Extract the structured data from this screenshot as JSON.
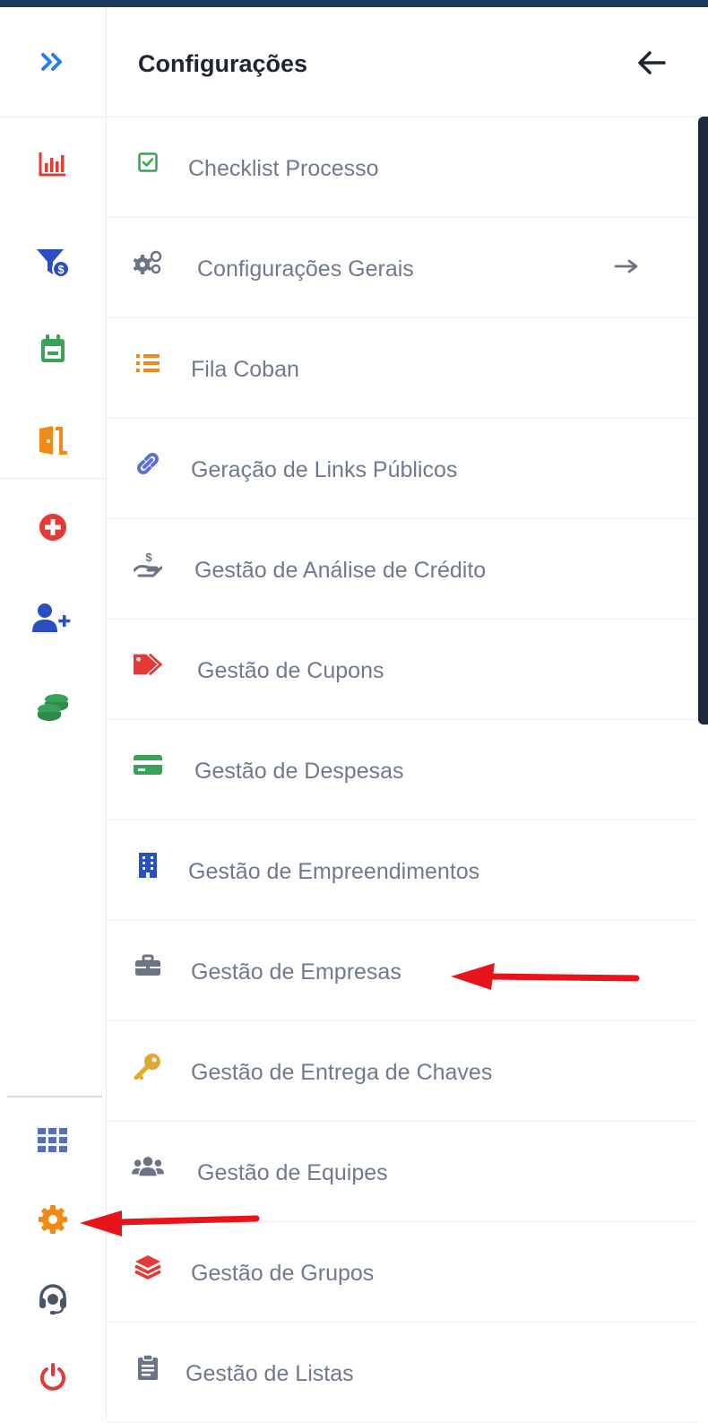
{
  "header": {
    "title": "Configurações"
  },
  "rail": {
    "items": [
      {
        "id": "expand",
        "icon": "double-chevron-right-icon",
        "color": "#2b7de9"
      },
      {
        "id": "reports",
        "icon": "bar-chart-icon",
        "color": "#e53935"
      },
      {
        "id": "funnel",
        "icon": "funnel-dollar-icon",
        "color": "#2b4fbf"
      },
      {
        "id": "calendar",
        "icon": "calendar-icon",
        "color": "#3aa15a"
      },
      {
        "id": "exit",
        "icon": "door-exit-icon",
        "color": "#f08a14"
      },
      {
        "id": "add",
        "icon": "plus-circle-icon",
        "color": "#e53935"
      },
      {
        "id": "add-user",
        "icon": "user-plus-icon",
        "color": "#2b4fbf"
      },
      {
        "id": "coins",
        "icon": "coins-icon",
        "color": "#3aa15a"
      },
      {
        "id": "apps",
        "icon": "grid-icon",
        "color": "#5b6fb0"
      },
      {
        "id": "settings",
        "icon": "gear-icon",
        "color": "#f08a14"
      },
      {
        "id": "support",
        "icon": "headset-icon",
        "color": "#4a5568"
      },
      {
        "id": "power",
        "icon": "power-icon",
        "color": "#e53935"
      }
    ]
  },
  "menu": {
    "items": [
      {
        "label": "Checklist Processo",
        "icon": "checkbox-icon",
        "color": "#3aa15a"
      },
      {
        "label": "Configurações Gerais",
        "icon": "cogs-icon",
        "color": "#6b7385",
        "arrow": "arrow-right-icon"
      },
      {
        "label": "Fila Coban",
        "icon": "list-icon",
        "color": "#f08a14"
      },
      {
        "label": "Geração de Links Públicos",
        "icon": "link-icon",
        "color": "#5b6fe0"
      },
      {
        "label": "Gestão de Análise de Crédito",
        "icon": "hand-dollar-icon",
        "color": "#6b7385"
      },
      {
        "label": "Gestão de Cupons",
        "icon": "tags-icon",
        "color": "#e53935"
      },
      {
        "label": "Gestão de Despesas",
        "icon": "credit-card-icon",
        "color": "#3aa15a"
      },
      {
        "label": "Gestão de Empreendimentos",
        "icon": "building-icon",
        "color": "#2b4fbf"
      },
      {
        "label": "Gestão de Empresas",
        "icon": "briefcase-icon",
        "color": "#6b7385"
      },
      {
        "label": "Gestão de Entrega de Chaves",
        "icon": "key-icon",
        "color": "#e0a82e"
      },
      {
        "label": "Gestão de Equipes",
        "icon": "users-icon",
        "color": "#6b7385"
      },
      {
        "label": "Gestão de Grupos",
        "icon": "layers-icon",
        "color": "#e53935"
      },
      {
        "label": "Gestão de Listas",
        "icon": "clipboard-icon",
        "color": "#6b7385"
      }
    ]
  },
  "annotations": {
    "arrow_color": "#e8141b"
  }
}
